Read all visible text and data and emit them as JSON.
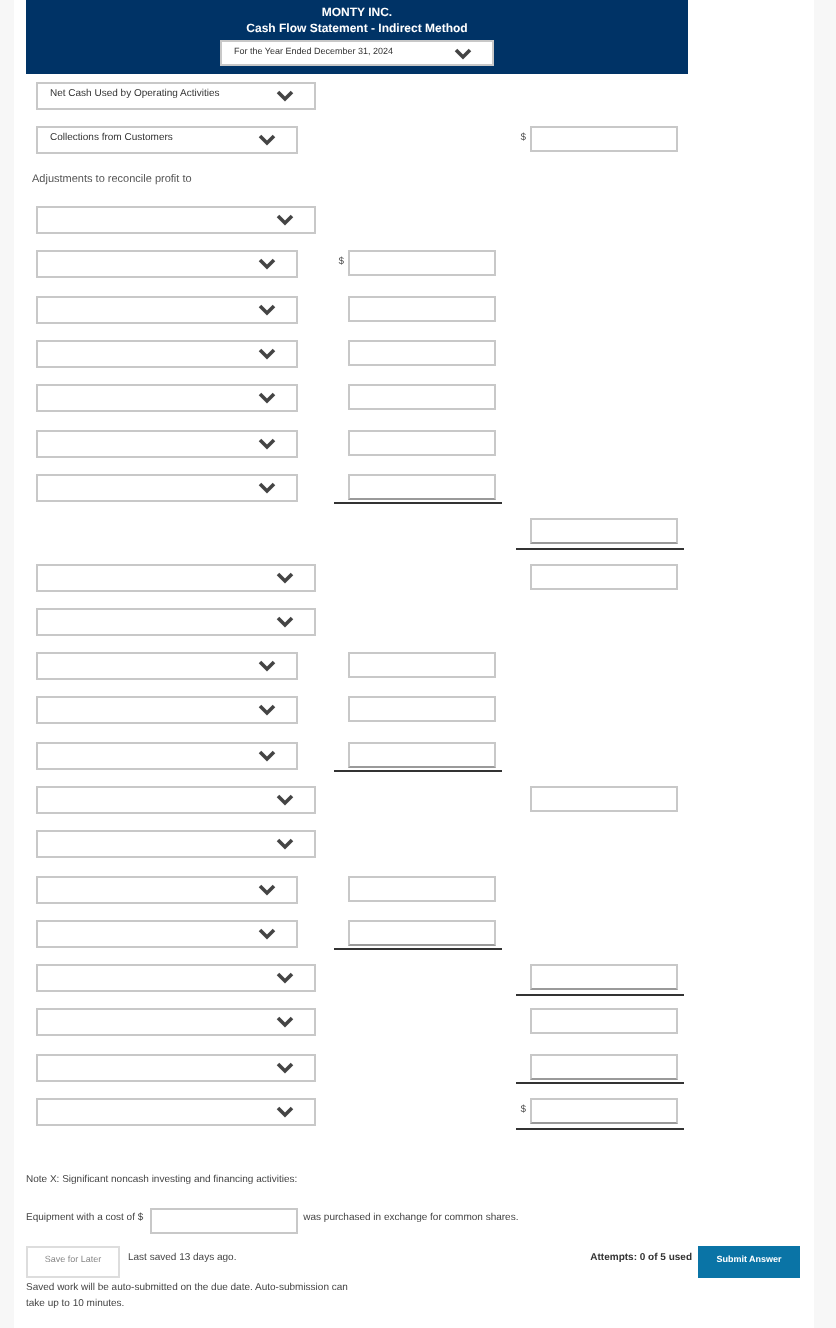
{
  "header": {
    "company": "MONTY INC.",
    "title": "Cash Flow Statement - Indirect Method",
    "period": "For the Year Ended December 31, 2024"
  },
  "rows": [
    {
      "kind": "wide",
      "value": "Net Cash Used by Operating Activities"
    },
    {
      "kind": "narrow",
      "value": "Collections from Customers",
      "outer": {
        "currency": "$",
        "underlined": false
      }
    },
    {
      "kind": "label",
      "value": "Adjustments to reconcile profit to"
    },
    {
      "kind": "wide"
    },
    {
      "kind": "narrow",
      "inner": {
        "currency": "$",
        "underlined": false
      }
    },
    {
      "kind": "narrow",
      "inner": {
        "underlined": false
      }
    },
    {
      "kind": "narrow",
      "inner": {
        "underlined": false
      }
    },
    {
      "kind": "narrow",
      "inner": {
        "underlined": false
      }
    },
    {
      "kind": "narrow",
      "inner": {
        "underlined": false
      }
    },
    {
      "kind": "narrow",
      "inner": {
        "underlined": true
      }
    },
    {
      "kind": "blank",
      "outer": {
        "underlined": true
      }
    },
    {
      "kind": "wide",
      "outer": {
        "underlined": false
      }
    },
    {
      "kind": "wide"
    },
    {
      "kind": "narrow",
      "inner": {
        "underlined": false
      }
    },
    {
      "kind": "narrow",
      "inner": {
        "underlined": false
      }
    },
    {
      "kind": "narrow",
      "inner": {
        "underlined": true
      }
    },
    {
      "kind": "wide",
      "outer": {
        "underlined": false
      }
    },
    {
      "kind": "wide"
    },
    {
      "kind": "narrow",
      "inner": {
        "underlined": false
      }
    },
    {
      "kind": "narrow",
      "inner": {
        "underlined": true
      }
    },
    {
      "kind": "wide",
      "outer": {
        "underlined": true
      }
    },
    {
      "kind": "wide",
      "outer": {
        "underlined": false
      }
    },
    {
      "kind": "wide",
      "outer": {
        "underlined": true
      }
    },
    {
      "kind": "wide",
      "outer": {
        "currency": "$",
        "underlined": true
      }
    }
  ],
  "note": {
    "heading": "Note X: Significant noncash investing and financing activities:",
    "before": "Equipment with a cost of $",
    "after": "was purchased in exchange for common shares."
  },
  "footer": {
    "save_button": "Save for Later",
    "last_saved": "Last saved 13 days ago.",
    "attempts": "Attempts: 0 of 5 used",
    "submit_button": "Submit Answer",
    "notice": "Saved work will be auto-submitted on the due date. Auto-submission can take up to 10 minutes."
  }
}
